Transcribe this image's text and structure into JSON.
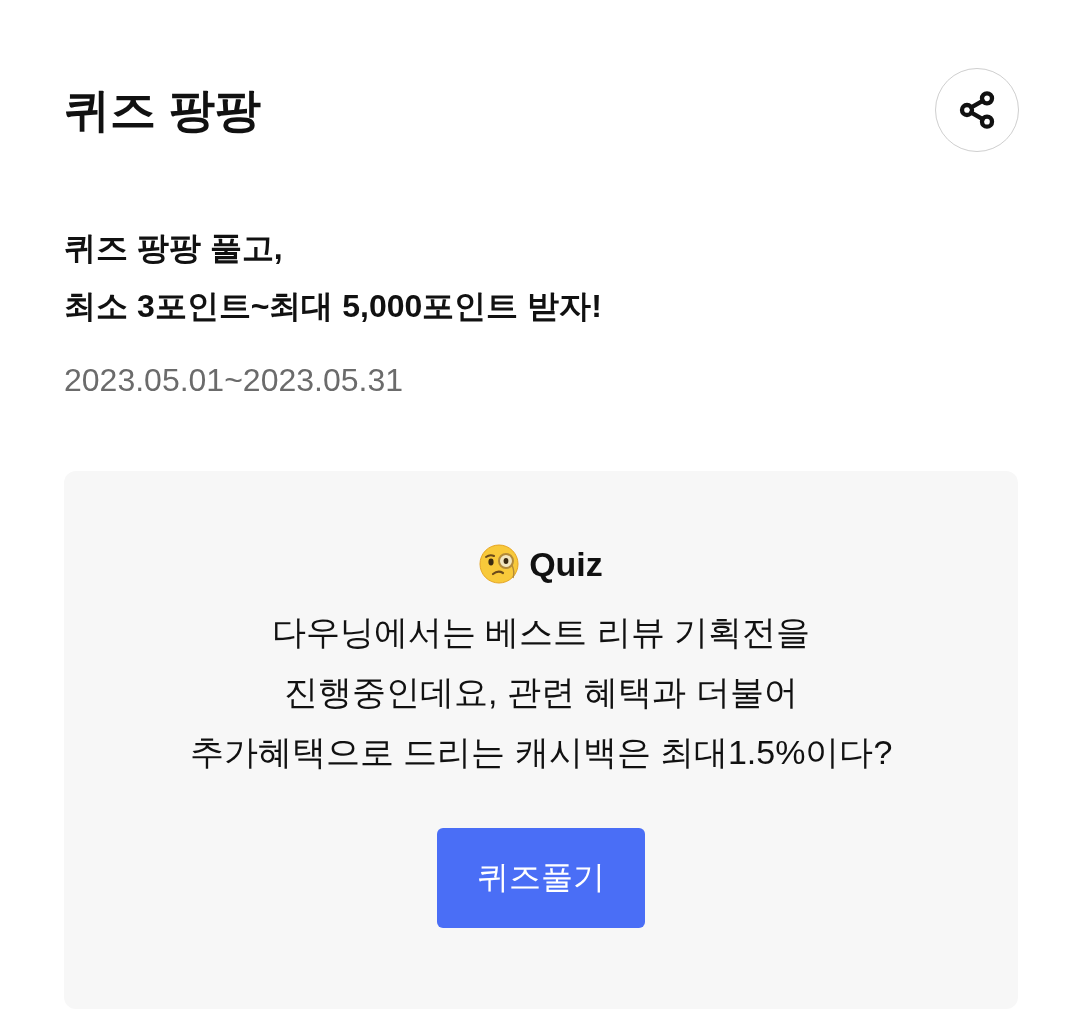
{
  "header": {
    "title": "퀴즈 팡팡"
  },
  "event": {
    "headline": "퀴즈 팡팡 풀고,\n최소 3포인트~최대 5,000포인트 받자!",
    "period": "2023.05.01~2023.05.31"
  },
  "quiz_card": {
    "label": "Quiz",
    "question": "다우닝에서는 베스트 리뷰 기획전을\n진행중인데요, 관련 혜택과 더불어\n추가혜택으로 드리는 캐시백은 최대1.5%이다?",
    "button": "퀴즈풀기"
  }
}
